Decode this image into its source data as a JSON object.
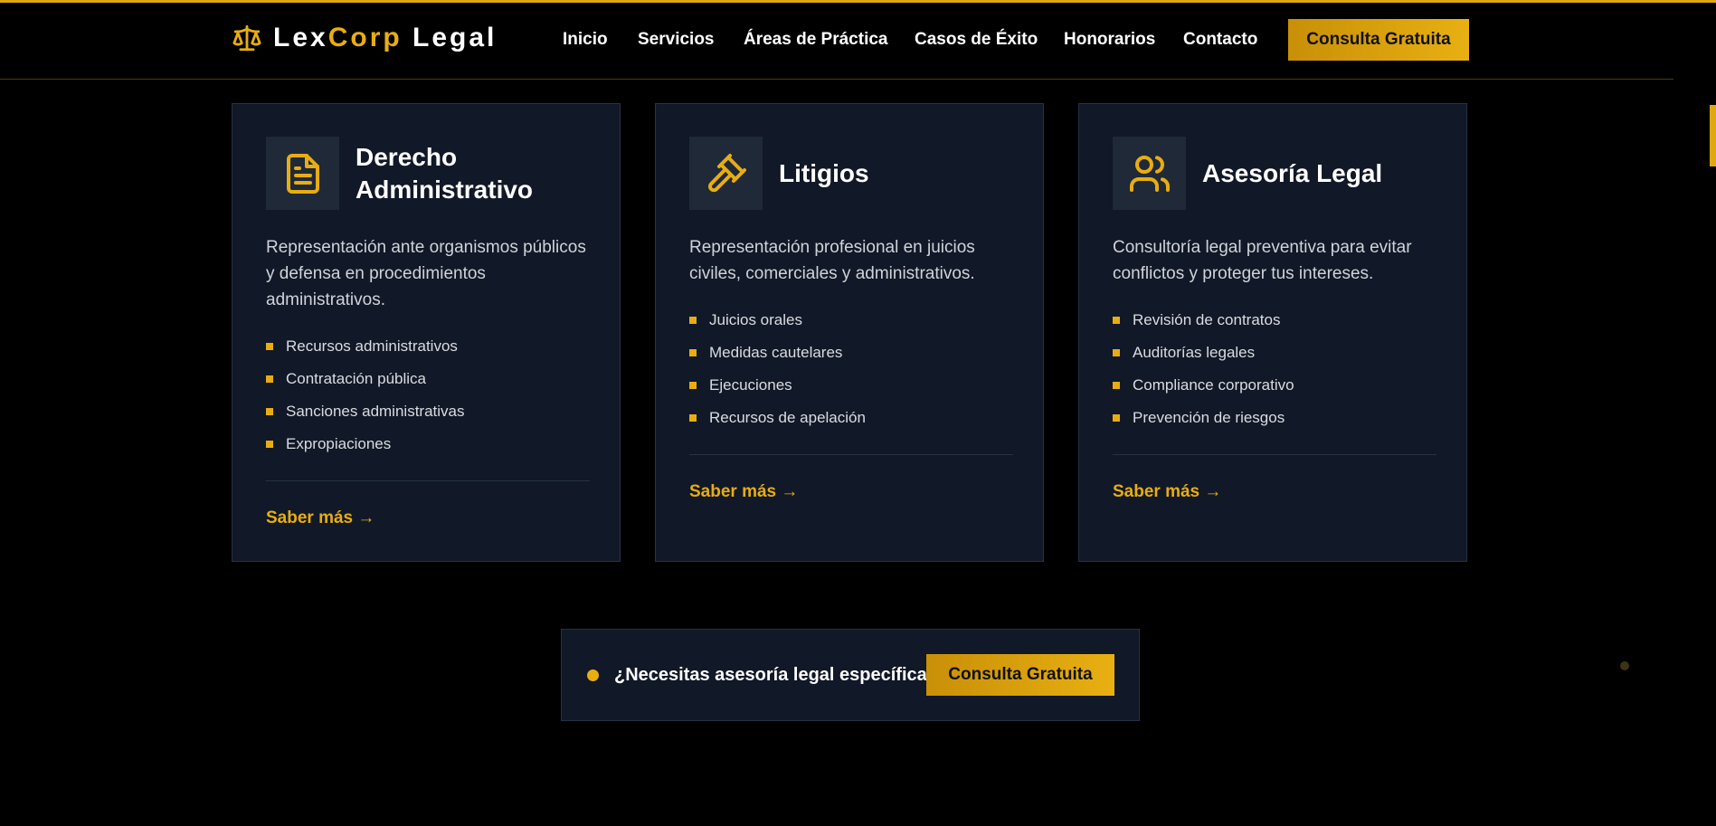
{
  "colors": {
    "accent": "#e8ad12",
    "background": "#000000",
    "card": "#111827",
    "icon_box": "#1f2937"
  },
  "brand": {
    "name_part1": "Lex",
    "name_part2": "Corp",
    "name_part3": " Legal",
    "icon": "scales-icon"
  },
  "nav": {
    "items": [
      "Inicio",
      "Servicios",
      "Áreas de Práctica",
      "Casos de Éxito",
      "Honorarios",
      "Contacto"
    ],
    "cta": "Consulta Gratuita"
  },
  "cards": [
    {
      "icon": "document-icon",
      "title": "Derecho Administrativo",
      "description": "Representación ante organismos públicos y defensa en procedimientos administrativos.",
      "items": [
        "Recursos administrativos",
        "Contratación pública",
        "Sanciones administrativas",
        "Expropiaciones"
      ],
      "link": "Saber más →"
    },
    {
      "icon": "gavel-icon",
      "title": "Litigios",
      "description": "Representación profesional en juicios civiles, comerciales y administrativos.",
      "items": [
        "Juicios orales",
        "Medidas cautelares",
        "Ejecuciones",
        "Recursos de apelación"
      ],
      "link": "Saber más →"
    },
    {
      "icon": "users-icon",
      "title": "Asesoría Legal",
      "description": "Consultoría legal preventiva para evitar conflictos y proteger tus intereses.",
      "items": [
        "Revisión de contratos",
        "Auditorías legales",
        "Compliance corporativo",
        "Prevención de riesgos"
      ],
      "link": "Saber más →"
    }
  ],
  "cta_bar": {
    "text": "¿Necesitas asesoría legal específica?",
    "button": "Consulta Gratuita"
  }
}
